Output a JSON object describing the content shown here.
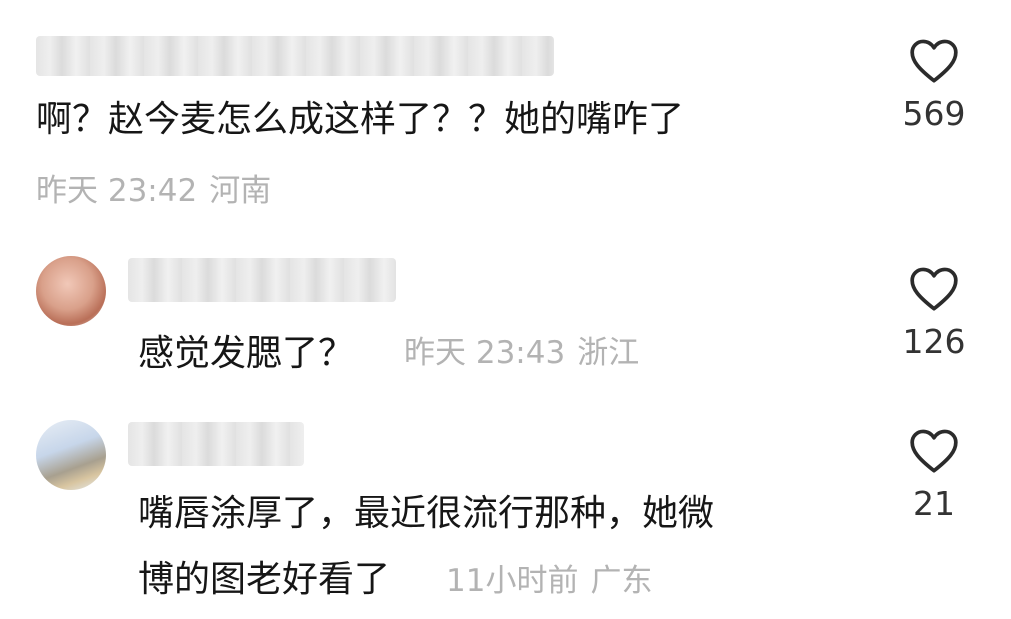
{
  "comments": [
    {
      "text": "啊？赵今麦怎么成这样了？？她的嘴咋了",
      "time": "昨天 23:42",
      "location": "河南",
      "likes": "569"
    },
    {
      "text": "感觉发腮了？",
      "time": "昨天 23:43",
      "location": "浙江",
      "likes": "126"
    },
    {
      "text_line1": "嘴唇涂厚了，最近很流行那种，她微",
      "text_line2": "博的图老好看了",
      "time": "11小时前",
      "location": "广东",
      "likes": "21"
    }
  ],
  "icons": {
    "like": "heart-outline-icon"
  }
}
